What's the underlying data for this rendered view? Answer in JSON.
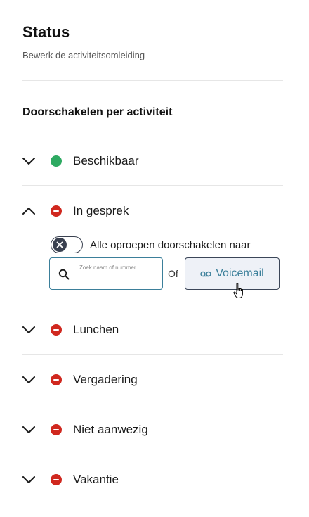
{
  "header": {
    "title": "Status",
    "subtitle": "Bewerk de activiteitsomleiding"
  },
  "section": {
    "title": "Doorschakelen per activiteit"
  },
  "activities": [
    {
      "label": "Beschikbaar",
      "status": "available",
      "color": "#2eaa62",
      "expanded": false
    },
    {
      "label": "In gesprek",
      "status": "busy",
      "color": "#d0281f",
      "expanded": true
    },
    {
      "label": "Lunchen",
      "status": "busy",
      "color": "#d0281f",
      "expanded": false
    },
    {
      "label": "Vergadering",
      "status": "busy",
      "color": "#d0281f",
      "expanded": false
    },
    {
      "label": "Niet aanwezig",
      "status": "busy",
      "color": "#d0281f",
      "expanded": false
    },
    {
      "label": "Vakantie",
      "status": "busy",
      "color": "#d0281f",
      "expanded": false
    }
  ],
  "forwarding": {
    "toggle_on": false,
    "toggle_label": "Alle oproepen doorschakelen naar",
    "search_placeholder": "Zoek naam of nummer",
    "or_label": "Of",
    "voicemail_label": "Voicemail"
  },
  "icons": {
    "expand": "chevron-down-icon",
    "collapse": "chevron-up-icon",
    "toggle_off": "x-icon",
    "search": "search-icon",
    "voicemail": "voicemail-icon",
    "cursor": "hand-pointer-icon"
  },
  "colors": {
    "accent": "#3b7f9a",
    "available": "#2eaa62",
    "busy": "#d0281f",
    "button_bg": "#eef1f7"
  }
}
